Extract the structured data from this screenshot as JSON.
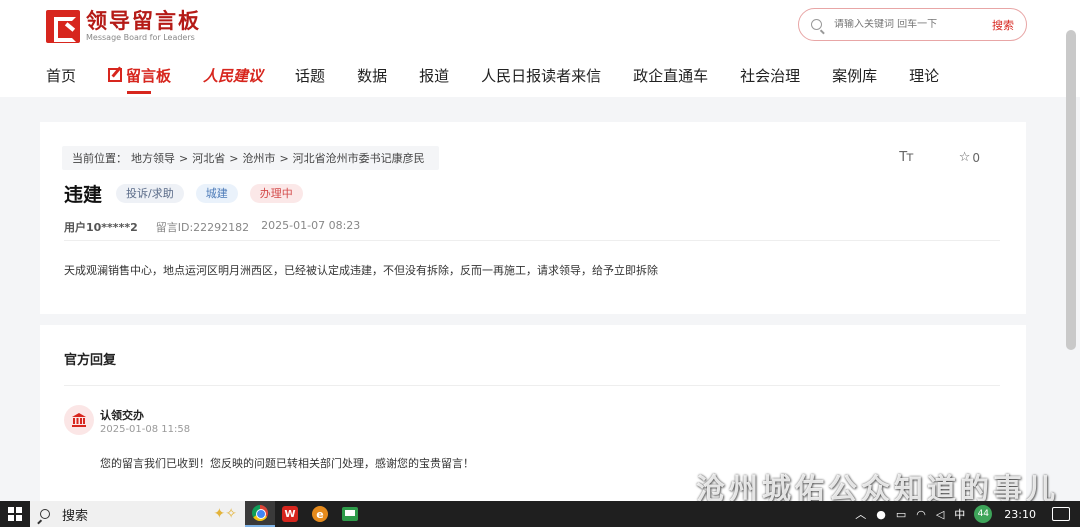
{
  "header": {
    "logo_cn": "领导留言板",
    "logo_en": "Message Board for Leaders",
    "search_placeholder": "请输入关键词 回车一下",
    "search_button": "搜索"
  },
  "nav": {
    "items": [
      "首页",
      "留言板",
      "人民建议",
      "话题",
      "数据",
      "报道",
      "人民日报读者来信",
      "政企直通车",
      "社会治理",
      "案例库",
      "理论"
    ],
    "active_index": 1
  },
  "message": {
    "breadcrumb": [
      "当前位置：",
      "地方领导",
      "河北省",
      "沧州市",
      "河北省沧州市委书记康彦民"
    ],
    "breadcrumb_sep": ">",
    "font_tool": "Tт",
    "favorite_count": "0",
    "title": "违建",
    "tags": [
      "投诉/求助",
      "城建",
      "办理中"
    ],
    "user": "用户10*****2",
    "message_id": "留言ID:22292182",
    "datetime": "2025-01-07 08:23",
    "content": "天成观澜销售中心，地点运河区明月洲西区，已经被认定成违建，不但没有拆除，反而一再施工，请求领导，给予立即拆除"
  },
  "reply": {
    "section_title": "官方回复",
    "name": "认领交办",
    "time": "2025-01-08 11:58",
    "content": "您的留言我们已收到！您反映的问题已转相关部门处理，感谢您的宝贵留言！"
  },
  "watermark": "沧州城佑公众知道的事儿",
  "taskbar": {
    "search_label": "搜索",
    "input_method": "中",
    "badge": "44",
    "time": "23:10"
  },
  "colors": {
    "brand_red": "#d7261e",
    "tag_gray": "#5a6b88",
    "tag_blue": "#4d7bb8",
    "tag_red": "#d44c4c"
  }
}
